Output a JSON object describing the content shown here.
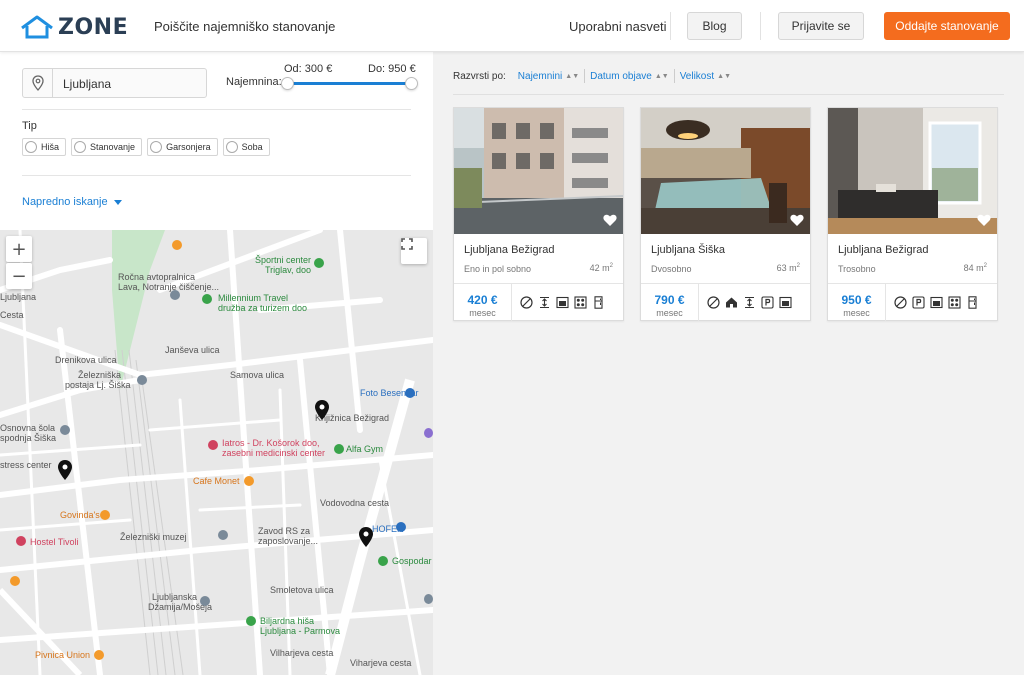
{
  "header": {
    "logo": "ZONE",
    "tagline": "Poiščite najemniško stanovanje",
    "tips_link": "Uporabni nasveti",
    "blog_button": "Blog",
    "login_button": "Prijavite se",
    "cta_button": "Oddajte stanovanje",
    "colors": {
      "accent": "#f46c1e",
      "link": "#1a7fd4",
      "logo": "#2b3f55"
    }
  },
  "filters": {
    "location_value": "Ljubljana",
    "location_icon": "map-pin-icon",
    "rent_label": "Najemnina:",
    "rent_from": "Od: 300 €",
    "rent_to": "Do: 950 €",
    "type_title": "Tip",
    "types": [
      "Hiša",
      "Stanovanje",
      "Garsonjera",
      "Soba"
    ],
    "advanced": "Napredno iskanje"
  },
  "map": {
    "zoom_in": "+",
    "zoom_out": "−",
    "labels": [
      "Ročna avtopralnica",
      "Lava, Notranje čiščenje...",
      "Športni center",
      "Triglav, doo",
      "Millennium Travel",
      "družba za turizem doo",
      "Železniška",
      "postaja Lj. Šiška",
      "Drenikova ulica",
      "Samova ulica",
      "Foto Besenčar",
      "Knjižnica Bežigrad",
      "Osnovna šola",
      "spodnja Šiška",
      "stress center",
      "Iatros - Dr. Košorok doo,",
      "zasebni medicinski center",
      "Alfa Gym",
      "Cafe Monet",
      "Govinda's",
      "Hostel Tivoli",
      "Železniški muzej",
      "Zavod RS za",
      "zaposlovanje...",
      "HOFER",
      "Gospodar",
      "Ljubljanska",
      "Džamija/Mošeja",
      "Biljardna hiša",
      "Ljubljana - Parmova",
      "Pivnica Union",
      "Viharjeva cesta",
      "Ljubljana",
      "Smoletova ulica",
      "Janševa ulica",
      "Vodovodna cesta",
      "Cesta",
      "Vilharjeva cesta"
    ]
  },
  "results": {
    "sort_label": "Razvrsti po:",
    "sort_options": [
      "Najemnini",
      "Datum objave",
      "Velikost"
    ],
    "per_month": "mesec",
    "listings": [
      {
        "location": "Ljubljana Bežigrad",
        "rooms": "Eno in pol sobno",
        "area": "42 m",
        "area_unit": "2",
        "price": "420 €",
        "features": [
          "no-pets-icon",
          "elevator-icon",
          "oven-icon",
          "stove-icon",
          "fridge-icon"
        ]
      },
      {
        "location": "Ljubljana Šiška",
        "rooms": "Dvosobno",
        "area": "63 m",
        "area_unit": "2",
        "price": "790 €",
        "features": [
          "no-pets-icon",
          "house-icon",
          "elevator-icon",
          "parking-icon",
          "oven-icon"
        ]
      },
      {
        "location": "Ljubljana Bežigrad",
        "rooms": "Trosobno",
        "area": "84 m",
        "area_unit": "2",
        "price": "950 €",
        "features": [
          "no-pets-icon",
          "parking-icon",
          "oven-icon",
          "stove-icon",
          "fridge-icon"
        ]
      }
    ]
  }
}
